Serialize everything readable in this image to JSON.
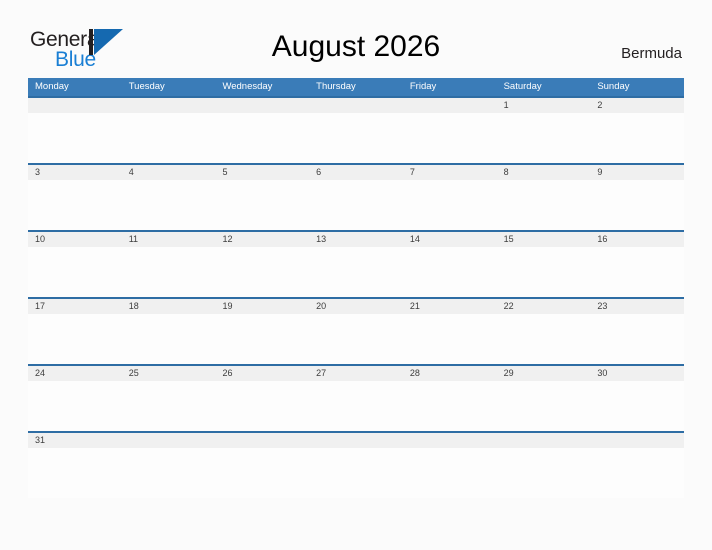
{
  "brand": {
    "word_one": "General",
    "word_two": "Blue",
    "mark_icon": "triangle-flag-logo-icon",
    "dark_color": "#231f20",
    "blue_color": "#1a7fd4",
    "mark_color": "#1569b0"
  },
  "header": {
    "title": "August 2026",
    "country": "Bermuda"
  },
  "colors": {
    "header_blue": "#3a7cb8",
    "separator_blue": "#2e6da4",
    "date_band_gray": "#f0f0f0",
    "page_background": "#fbfbfb",
    "cell_background": "#fdfdfd",
    "date_text": "#3d3d3d"
  },
  "calendar": {
    "month": "August",
    "year": "2026",
    "weekday_headers": [
      "Monday",
      "Tuesday",
      "Wednesday",
      "Thursday",
      "Friday",
      "Saturday",
      "Sunday"
    ],
    "weeks": [
      [
        "",
        "",
        "",
        "",
        "",
        "1",
        "2"
      ],
      [
        "3",
        "4",
        "5",
        "6",
        "7",
        "8",
        "9"
      ],
      [
        "10",
        "11",
        "12",
        "13",
        "14",
        "15",
        "16"
      ],
      [
        "17",
        "18",
        "19",
        "20",
        "21",
        "22",
        "23"
      ],
      [
        "24",
        "25",
        "26",
        "27",
        "28",
        "29",
        "30"
      ],
      [
        "31",
        "",
        "",
        "",
        "",
        "",
        ""
      ]
    ]
  }
}
